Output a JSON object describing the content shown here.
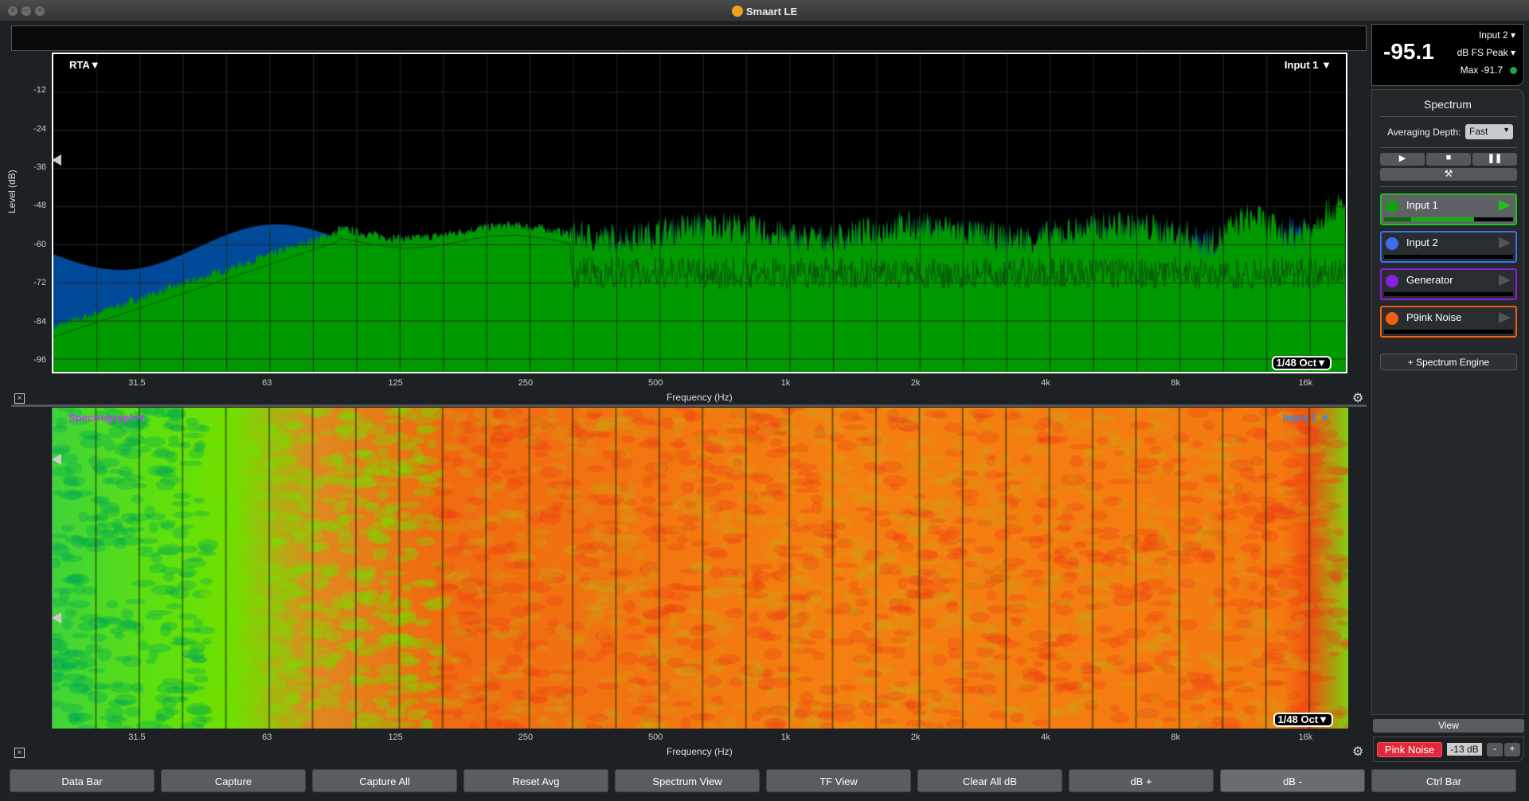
{
  "window": {
    "title": "Smaart LE"
  },
  "rta": {
    "mode_label": "RTA▼",
    "input_label": "Input 1 ▼",
    "resolution": "1/48 Oct▼",
    "ylabel": "Level (dB)",
    "xlabel": "Frequency (Hz)",
    "yticks": [
      "-12",
      "-24",
      "-36",
      "-48",
      "-60",
      "-72",
      "-84",
      "-96"
    ],
    "xticks": [
      "31.5",
      "63",
      "125",
      "250",
      "500",
      "1k",
      "2k",
      "4k",
      "8k",
      "16k"
    ],
    "ylim": [
      -100,
      0
    ],
    "xlim_hz": [
      20,
      20000
    ]
  },
  "spectrograph": {
    "mode_label": "Spectrograph▼",
    "input_label": "Input 1 ▼",
    "resolution": "1/48 Oct▼",
    "xlabel": "Frequency (Hz)",
    "xticks": [
      "31.5",
      "63",
      "125",
      "250",
      "500",
      "1k",
      "2k",
      "4k",
      "8k",
      "16k"
    ]
  },
  "meter": {
    "value": "-95.1",
    "input": "Input 2",
    "units": "dB FS Peak",
    "max": "Max -91.7",
    "status_color": "#1fa83a"
  },
  "panel": {
    "title": "Spectrum",
    "averaging_label": "Averaging Depth:",
    "averaging_value": "Fast",
    "sources": [
      {
        "name": "Input 1",
        "color": "#12a012",
        "border": "#1fc01f",
        "active": true,
        "level": 0.7
      },
      {
        "name": "Input 2",
        "color": "#3a6ff0",
        "border": "#3a6ff0",
        "active": false,
        "level": 0
      },
      {
        "name": "Generator",
        "color": "#8a1fe0",
        "border": "#8a1fe0",
        "active": false,
        "level": 0
      },
      {
        "name": "P9ink Noise",
        "color": "#f06010",
        "border": "#f06010",
        "active": false,
        "level": 0
      }
    ],
    "add_engine": "+ Spectrum Engine",
    "view": "View",
    "pink_noise": "Pink Noise",
    "gen_level": "-13 dB",
    "minus": "-",
    "plus": "+"
  },
  "bottom_bar": [
    "Data Bar",
    "Capture",
    "Capture All",
    "Reset Avg",
    "Spectrum View",
    "TF View",
    "Clear All dB",
    "dB +",
    "dB -",
    "Ctrl Bar"
  ],
  "colors": {
    "rta_fill": "#009900",
    "rta_peak": "#004a99",
    "trace": "#0a5a0a",
    "spectro_label": "#c040f0",
    "spectro_input": "#2a8ff0"
  }
}
